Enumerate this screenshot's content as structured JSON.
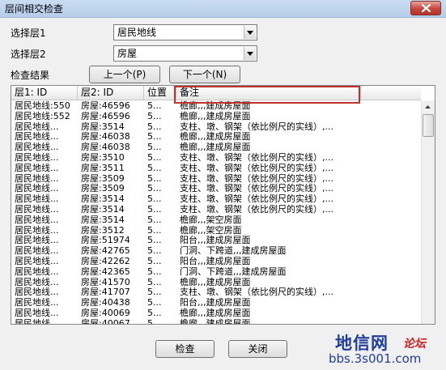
{
  "window": {
    "title": "层间相交检查"
  },
  "form": {
    "layer1_label": "选择层1",
    "layer1_value": "居民地线",
    "layer2_label": "选择层2",
    "layer2_value": "房屋",
    "results_label": "检查结果",
    "prev_button": "上一个(P)",
    "next_button": "下一个(N)"
  },
  "table": {
    "columns": [
      "层1: ID",
      "层2: ID",
      "位置",
      "备注"
    ],
    "rows": [
      [
        "居民地线:550",
        "房屋:46596",
        "5...",
        "檐廊,,,建成房屋面"
      ],
      [
        "居民地线:552",
        "房屋:46596",
        "5...",
        "檐廊,,,建成房屋面"
      ],
      [
        "居民地线...",
        "房屋:3514",
        "5...",
        "支柱、墩、钢架（依比例尺的实线）,..."
      ],
      [
        "居民地线...",
        "房屋:46038",
        "5...",
        "檐廊,,,建成房屋面"
      ],
      [
        "居民地线...",
        "房屋:46038",
        "5...",
        "檐廊,,,建成房屋面"
      ],
      [
        "居民地线...",
        "房屋:3510",
        "5...",
        "支柱、墩、钢架（依比例尺的实线）,..."
      ],
      [
        "居民地线...",
        "房屋:3511",
        "5...",
        "支柱、墩、钢架（依比例尺的实线）,..."
      ],
      [
        "居民地线...",
        "房屋:3509",
        "5...",
        "支柱、墩、钢架（依比例尺的实线）,..."
      ],
      [
        "居民地线...",
        "房屋:3509",
        "5...",
        "支柱、墩、钢架（依比例尺的实线）,..."
      ],
      [
        "居民地线...",
        "房屋:3514",
        "5...",
        "支柱、墩、钢架（依比例尺的实线）,..."
      ],
      [
        "居民地线...",
        "房屋:3514",
        "5...",
        "支柱、墩、钢架（依比例尺的实线）,..."
      ],
      [
        "居民地线...",
        "房屋:3514",
        "5...",
        "檐廊,,,架空房面"
      ],
      [
        "居民地线...",
        "房屋:3512",
        "5...",
        "檐廊,,,架空房面"
      ],
      [
        "居民地线...",
        "房屋:51974",
        "5...",
        "阳台,,,建成房屋面"
      ],
      [
        "居民地线...",
        "房屋:42765",
        "5...",
        "门洞、下跨道,,,建成房屋面"
      ],
      [
        "居民地线...",
        "房屋:42262",
        "5...",
        "阳台,,,建成房屋面"
      ],
      [
        "居民地线...",
        "房屋:42365",
        "5...",
        "门洞、下跨道,,,建成房屋面"
      ],
      [
        "居民地线...",
        "房屋:41570",
        "5...",
        "檐廊,,,建成房屋面"
      ],
      [
        "居民地线...",
        "房屋:41707",
        "5...",
        "支柱、墩、钢架（依比例尺的实线）,..."
      ],
      [
        "居民地线...",
        "房屋:40438",
        "5...",
        "阳台,,,建成房屋面"
      ],
      [
        "居民地线...",
        "房屋:40069",
        "5...",
        "檐廊,,,建成房屋面"
      ],
      [
        "居民地线...",
        "房屋:40067",
        "5...",
        "檐廊,,,建成房屋面"
      ]
    ]
  },
  "footer": {
    "check_button": "检查",
    "close_button": "关闭"
  },
  "watermark": {
    "name": "地信网",
    "forum": "论坛",
    "url": "bbs.3s001.com"
  },
  "colors": {
    "highlight_border": "#c0312c",
    "close_button_red": "#c6453a",
    "watermark_blue": "#1e3e9e",
    "watermark_red": "#d22020"
  },
  "icons": {
    "close": "close-icon",
    "dropdown": "chevron-down-icon",
    "scroll_up": "scroll-up-arrow-icon"
  }
}
